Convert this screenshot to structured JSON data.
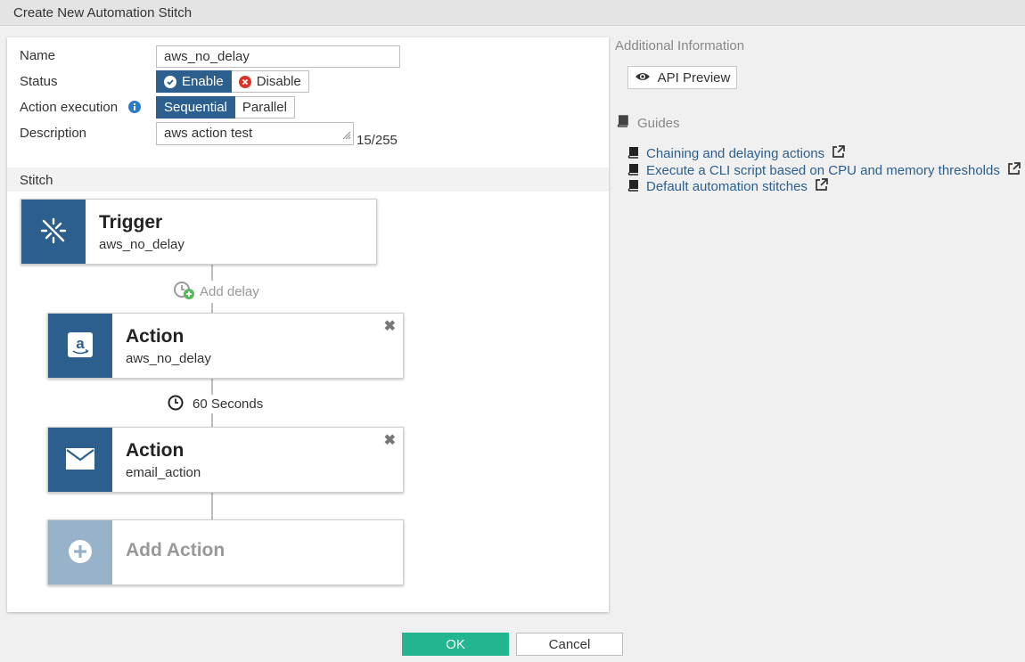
{
  "window": {
    "title": "Create New Automation Stitch"
  },
  "form": {
    "name_label": "Name",
    "name_value": "aws_no_delay",
    "status_label": "Status",
    "status_enable": "Enable",
    "status_disable": "Disable",
    "exec_label": "Action execution",
    "exec_sequential": "Sequential",
    "exec_parallel": "Parallel",
    "desc_label": "Description",
    "desc_value": "aws action test",
    "desc_counter": "15/255"
  },
  "stitch": {
    "header": "Stitch",
    "trigger": {
      "title": "Trigger",
      "subtitle": "aws_no_delay",
      "icon": "trigger-icon"
    },
    "add_delay_label": "Add delay",
    "actions": [
      {
        "title": "Action",
        "subtitle": "aws_no_delay",
        "icon": "amazon-icon"
      },
      {
        "title": "Action",
        "subtitle": "email_action",
        "icon": "envelope-icon"
      }
    ],
    "delay_label": "60 Seconds",
    "add_action_label": "Add Action"
  },
  "sidebar": {
    "heading": "Additional Information",
    "api_preview_label": "API Preview",
    "guides_heading": "Guides",
    "guides": [
      "Chaining and delaying actions",
      "Execute a CLI script based on CPU and memory thresholds",
      "Default automation stitches"
    ]
  },
  "footer": {
    "ok_label": "OK",
    "cancel_label": "Cancel"
  },
  "colors": {
    "accent": "#2c5f8d",
    "ok": "#22b58f",
    "link": "#2c5f8d",
    "disable": "#d9342b"
  }
}
